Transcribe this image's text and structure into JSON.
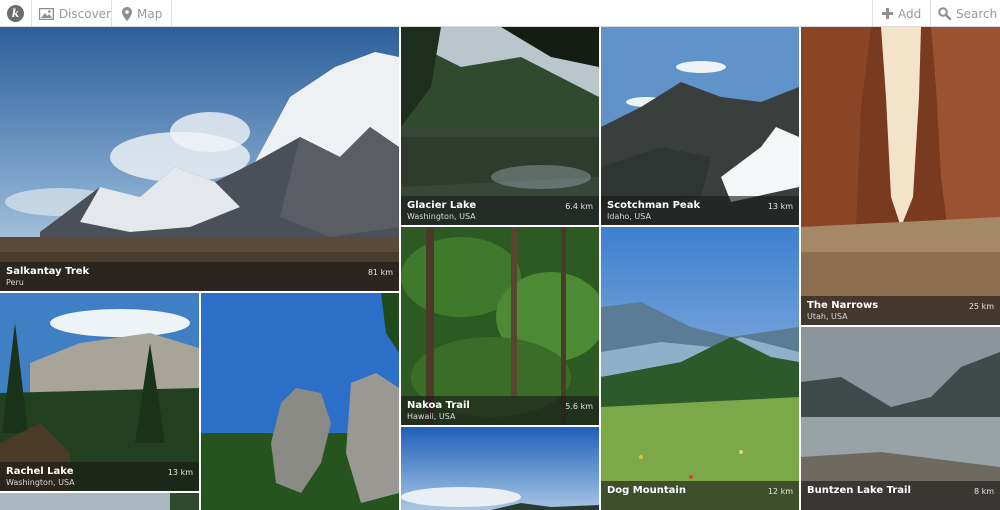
{
  "nav": {
    "discover_label": "Discover",
    "map_label": "Map",
    "add_label": "Add",
    "search_label": "Search"
  },
  "trails": [
    {
      "name": "Salkantay Trek",
      "location": "Peru",
      "distance": "81 km"
    },
    {
      "name": "Glacier Lake",
      "location": "Washington, USA",
      "distance": "6.4 km"
    },
    {
      "name": "Scotchman Peak",
      "location": "Idaho, USA",
      "distance": "13 km"
    },
    {
      "name": "The Narrows",
      "location": "Utah, USA",
      "distance": "25 km"
    },
    {
      "name": "Rachel Lake",
      "location": "Washington, USA",
      "distance": "13 km"
    },
    {
      "name": "Nakoa Trail",
      "location": "Hawaii, USA",
      "distance": "5.6 km"
    },
    {
      "name": "Dog Mountain",
      "location": "",
      "distance": "12 km"
    },
    {
      "name": "Buntzen Lake Trail",
      "location": "",
      "distance": "8 km"
    }
  ],
  "colors": {
    "caption_bg": "#191919",
    "nav_text": "#9a9a9a",
    "nav_border": "#dedede"
  }
}
